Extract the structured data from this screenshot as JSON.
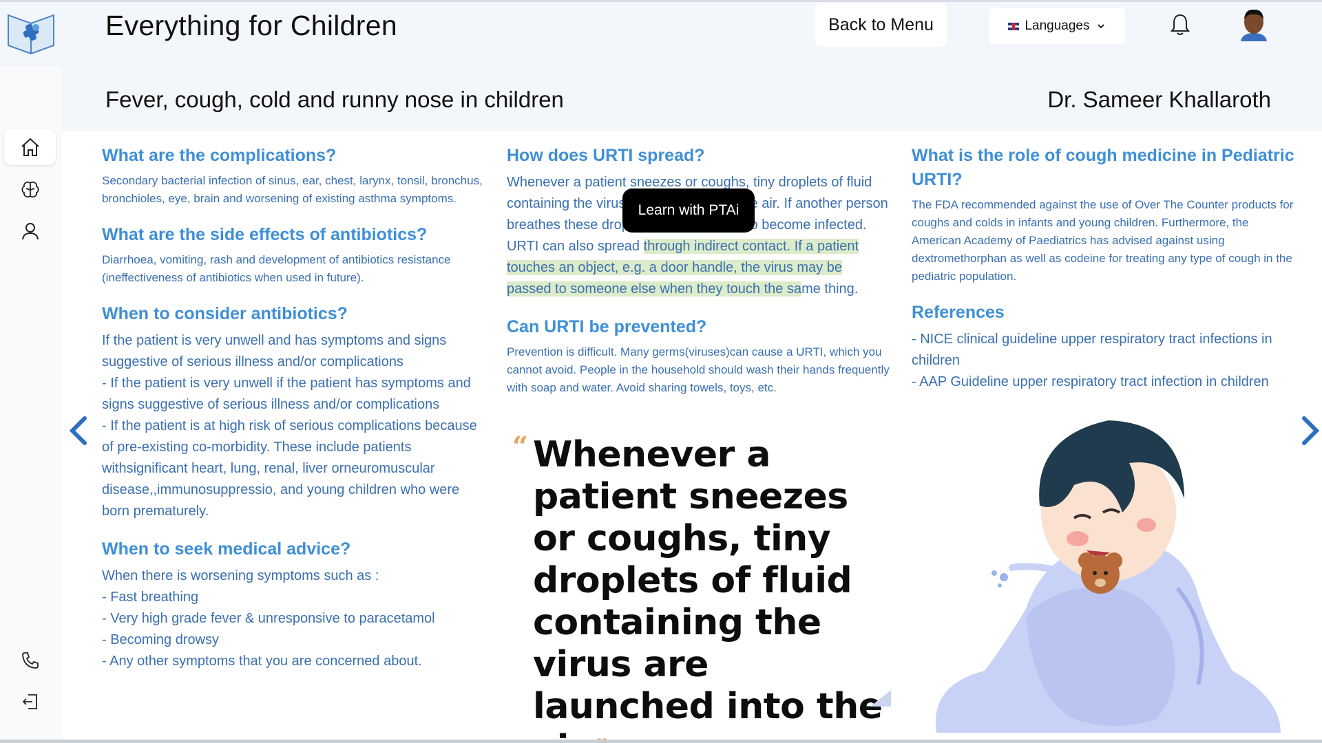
{
  "header": {
    "app_title": "Everything for Children",
    "back_label": "Back to Menu",
    "language_label": "Languages"
  },
  "article": {
    "title": "Fever, cough, cold and runny nose in children",
    "author": "Dr. Sameer Khallaroth"
  },
  "left_column": {
    "complications": {
      "heading": "What are the complications?",
      "body": "Secondary bacterial infection of sinus, ear, chest, larynx, tonsil, bronchus, bronchioles, eye, brain and worsening of existing asthma symptoms."
    },
    "side_effects": {
      "heading": "What are the side effects of antibiotics?",
      "body": "Diarrhoea, vomiting, rash and development of antibiotics resistance (ineffectiveness of antibiotics when used in future)."
    },
    "consider_antibiotics": {
      "heading": "When to consider antibiotics?",
      "lines": [
        "If the patient is very unwell and has symptoms and signs suggestive of serious illness and/or complications",
        "- If the patient is very unwell if the patient has symptoms and signs suggestive of serious illness and/or complications",
        "- If the patient is at high risk of serious complications because of pre-existing co-morbidity. These include patients withsignificant heart, lung, renal, liver orneuromuscular disease,,immunosuppressio, and young children who were born prematurely."
      ]
    },
    "seek_advice": {
      "heading": "When to seek medical advice?",
      "lines": [
        "When there is worsening symptoms such as :",
        "- Fast breathing",
        "- Very high grade fever & unresponsive to paracetamol",
        "- Becoming drowsy",
        "- Any other symptoms that you are concerned about."
      ]
    }
  },
  "middle_column": {
    "spread": {
      "heading": "How does URTI spread?",
      "part1": "Whenever a patient sneezes or coughs, tiny droplets of fluid containing the virus are launched into the air. If another person breathes these droplets in, they may also become infected. URTI can also spread ",
      "highlight": "through indirect contact. If a patient touches an object, e.g. a door handle, the virus may be passed to someone else when they touch the sa",
      "part2": "me thing."
    },
    "prevented": {
      "heading": "Can URTI be prevented?",
      "body": "Prevention is difficult. Many germs(viruses)can cause a URTI, which you cannot avoid. People in the household should wash their hands frequently with soap and water. Avoid sharing towels, toys, etc."
    },
    "tooltip": "Learn with PTAi",
    "quote": {
      "open": "“",
      "text": "Whenever a patient sneezes or coughs, tiny droplets of fluid containing the virus are launched into the air.",
      "close": "”"
    }
  },
  "right_column": {
    "cough_medicine": {
      "heading": "What is the role of cough medicine in Pediatric URTI?",
      "body": "The FDA recommended against the use of Over The Counter products for coughs and colds in infants and young children. Furthermore, the American Academy of Paediatrics has advised against using dextromethorphan as well as codeine for treating any type of cough in the pediatric population."
    },
    "references": {
      "heading": "References",
      "items": [
        "- NICE clinical guideline upper respiratory tract infections in children",
        "- AAP Guideline upper respiratory tract infection in children"
      ]
    }
  },
  "colors": {
    "heading_blue": "#3f8fd6",
    "body_blue": "#3a6fb0",
    "highlight_green": "#dcebc9",
    "quote_accent": "#e8a35a"
  },
  "icons": {
    "sidebar": [
      "home-icon",
      "brain-icon",
      "user-icon",
      "phone-icon",
      "logout-icon"
    ],
    "header": [
      "book-logo-icon",
      "uk-flag-icon",
      "chevron-down-icon",
      "bell-icon",
      "avatar"
    ],
    "navigation": [
      "chevron-left-icon",
      "chevron-right-icon"
    ]
  }
}
